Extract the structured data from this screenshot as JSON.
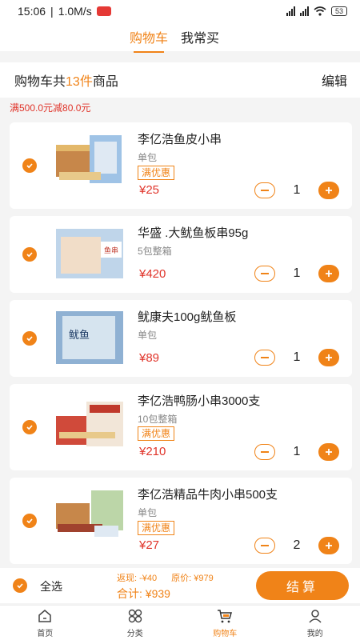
{
  "status": {
    "time": "15:06",
    "speed": "1.0M/s",
    "battery": "53"
  },
  "tabs": {
    "cart": "购物车",
    "frequent": "我常买"
  },
  "header": {
    "prefix": "购物车共",
    "count": "13件",
    "suffix": "商品",
    "edit": "编辑"
  },
  "promo": "满500.0元减80.0元",
  "items": [
    {
      "title": "李亿浩鱼皮小串",
      "spec": "单包",
      "tag": "满优惠",
      "price": "¥25",
      "qty": "1"
    },
    {
      "title": "华盛 .大鱿鱼板串95g",
      "spec": "5包整箱",
      "tag": "",
      "price": "¥420",
      "qty": "1"
    },
    {
      "title": "鱿康夫100g鱿鱼板",
      "spec": "单包",
      "tag": "",
      "price": "¥89",
      "qty": "1"
    },
    {
      "title": "李亿浩鸭肠小串3000支",
      "spec": "10包整箱",
      "tag": "满优惠",
      "price": "¥210",
      "qty": "1"
    },
    {
      "title": "李亿浩精品牛肉小串500支",
      "spec": "单包",
      "tag": "满优惠",
      "price": "¥27",
      "qty": "2"
    }
  ],
  "footer": {
    "select_all": "全选",
    "rebate": "返现: -¥40",
    "original": "原价: ¥979",
    "total": "合计: ¥939",
    "checkout": "结算"
  },
  "nav": [
    {
      "label": "首页",
      "icon": "home-icon"
    },
    {
      "label": "分类",
      "icon": "category-icon"
    },
    {
      "label": "购物车",
      "icon": "cart-icon"
    },
    {
      "label": "我的",
      "icon": "profile-icon"
    }
  ],
  "colors": {
    "accent": "#f08318",
    "price": "#e0342a"
  }
}
